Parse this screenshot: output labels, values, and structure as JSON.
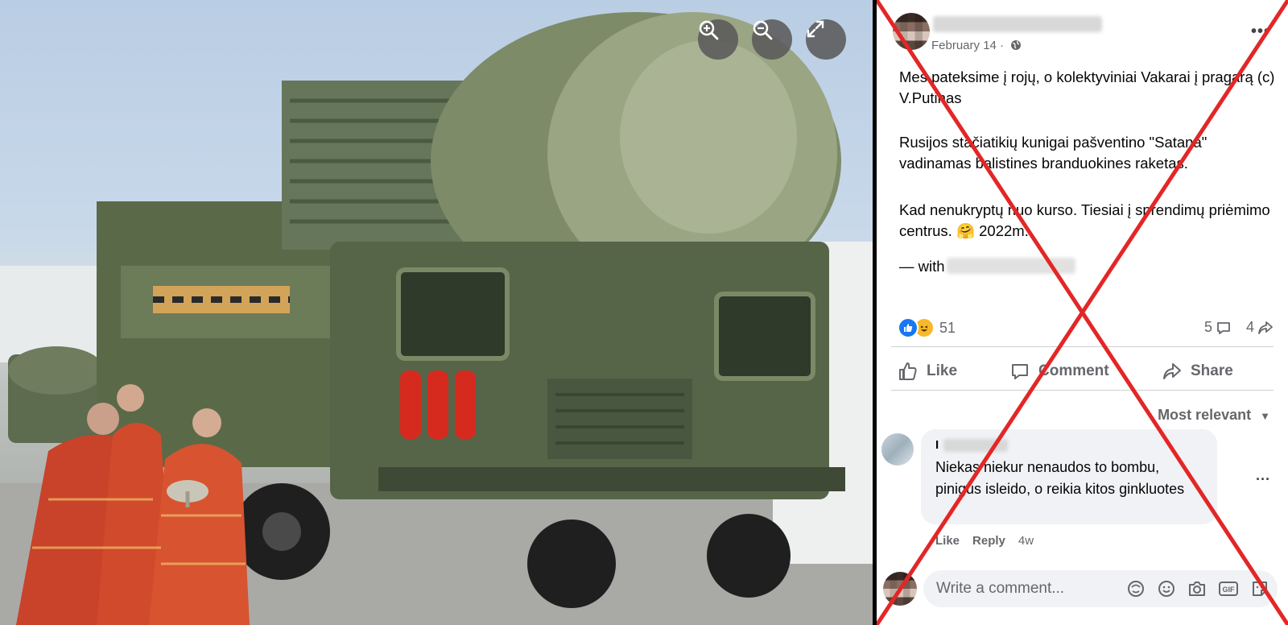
{
  "viewer": {
    "zoom_in_icon": "zoom-in-icon",
    "zoom_out_icon": "zoom-out-icon",
    "fullscreen_icon": "expand-icon"
  },
  "post": {
    "date": "February 14",
    "more_icon": "•••",
    "paragraphs": [
      "Mes pateksime į rojų, o kolektyviniai Vakarai į pragarą (c) V.Putinas",
      "Rusijos stačiatikių kunigai pašventino \"Satana\" vadinamas balistines branduokines raketas.",
      "Kad nenukryptų nuo kurso. Tiesiai į sprendimų priėmimo centrus.",
      "2022m."
    ],
    "emoji": "🤗",
    "with_prefix": "— with",
    "reaction_count": "51",
    "comment_count": "5",
    "share_count": "4",
    "like_label": "Like",
    "comment_label": "Comment",
    "share_label": "Share",
    "sort_label": "Most relevant"
  },
  "comment": {
    "name_initial": "I",
    "text": "Niekas niekur nenaudos to bombu, pinigus isleido, o reikia kitos ginkluotes",
    "like_label": "Like",
    "reply_label": "Reply",
    "age": "4w",
    "more_icon": "···"
  },
  "composer": {
    "placeholder": "Write a comment...",
    "gif_label": "GIF"
  },
  "colors": {
    "fb_blue": "#1877f2",
    "reaction_yellow": "#f7b928",
    "cross_red": "#e32626",
    "muted_text": "#65676b"
  }
}
